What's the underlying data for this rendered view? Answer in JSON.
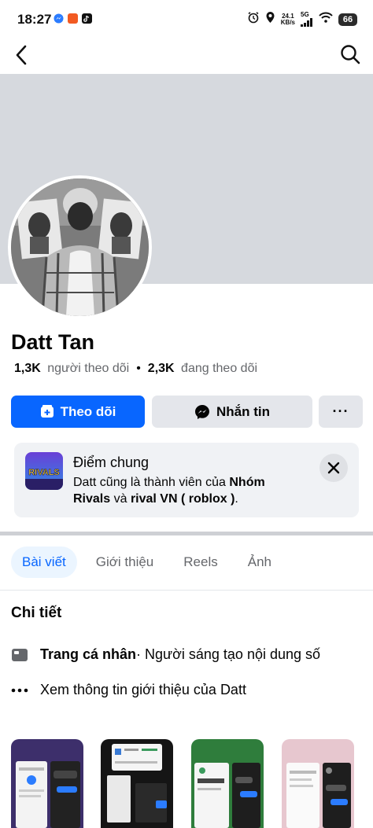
{
  "status_bar": {
    "time": "18:27",
    "net_speed_value": "24.1",
    "net_speed_unit": "KB/s",
    "network": "5G",
    "battery": "66"
  },
  "header": {
    "back_icon": "arrow-left-icon",
    "search_icon": "search-icon"
  },
  "profile": {
    "name": "Datt Tan",
    "followers_count": "1,3K",
    "followers_label": "người theo dõi",
    "following_count": "2,3K",
    "following_label": "đang theo dõi"
  },
  "actions": {
    "follow_label": "Theo dõi",
    "message_label": "Nhắn tin",
    "more_label": "···"
  },
  "mutual": {
    "title": "Điểm chung",
    "text_prefix": "Datt cũng là thành viên của ",
    "group1": "Nhóm Rivals",
    "text_mid": " và ",
    "group2": "rival VN ( roblox )",
    "text_suffix": ".",
    "thumb_text": "RIVALS"
  },
  "tabs": [
    {
      "label": "Bài viết",
      "active": true
    },
    {
      "label": "Giới thiệu",
      "active": false
    },
    {
      "label": "Reels",
      "active": false
    },
    {
      "label": "Ảnh",
      "active": false
    }
  ],
  "details": {
    "title": "Chi tiết",
    "page_type_bold": "Trang cá nhân",
    "page_type_rest": " · Người sáng tạo nội dung số",
    "about_link": "Xem thông tin giới thiệu của Datt"
  },
  "colors": {
    "accent": "#0866ff",
    "cover": "#d6d9de",
    "secondary_button": "#e4e6eb"
  }
}
